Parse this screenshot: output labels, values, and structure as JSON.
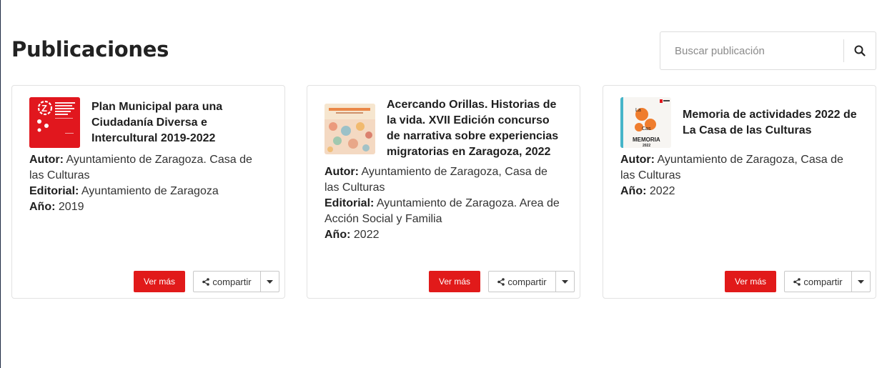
{
  "page": {
    "title": "Publicaciones"
  },
  "search": {
    "placeholder": "Buscar publicación"
  },
  "labels": {
    "author": "Autor:",
    "publisher": "Editorial:",
    "year": "Año:"
  },
  "actions": {
    "more": "Ver más",
    "share": "compartir"
  },
  "colors": {
    "accent": "#e11a1a",
    "border": "#e2e2e2"
  },
  "icons": {
    "search": "search-icon",
    "share": "share-icon",
    "caret": "caret-down-icon"
  },
  "publications": [
    {
      "title": "Plan Municipal para una Ciudadanía Diversa e Intercultural 2019-2022",
      "author": "Ayuntamiento de Zaragoza. Casa de las Culturas",
      "publisher": "Ayuntamiento de Zaragoza",
      "year": "2019"
    },
    {
      "title": "Acercando Orillas. Historias de la vida. XVII Edición concurso de narrativa sobre experiencias migratorias en Zaragoza, 2022",
      "author": "Ayuntamiento de Zaragoza, Casa de las Culturas",
      "publisher": "Ayuntamiento de Zaragoza. Area de Acción Social y Familia",
      "year": "2022"
    },
    {
      "title": "Memoria de actividades 2022 de La Casa de las Culturas",
      "author": "Ayuntamiento de Zaragoza, Casa de las Culturas",
      "year": "2022",
      "cover_text": "MEMORIA"
    }
  ]
}
